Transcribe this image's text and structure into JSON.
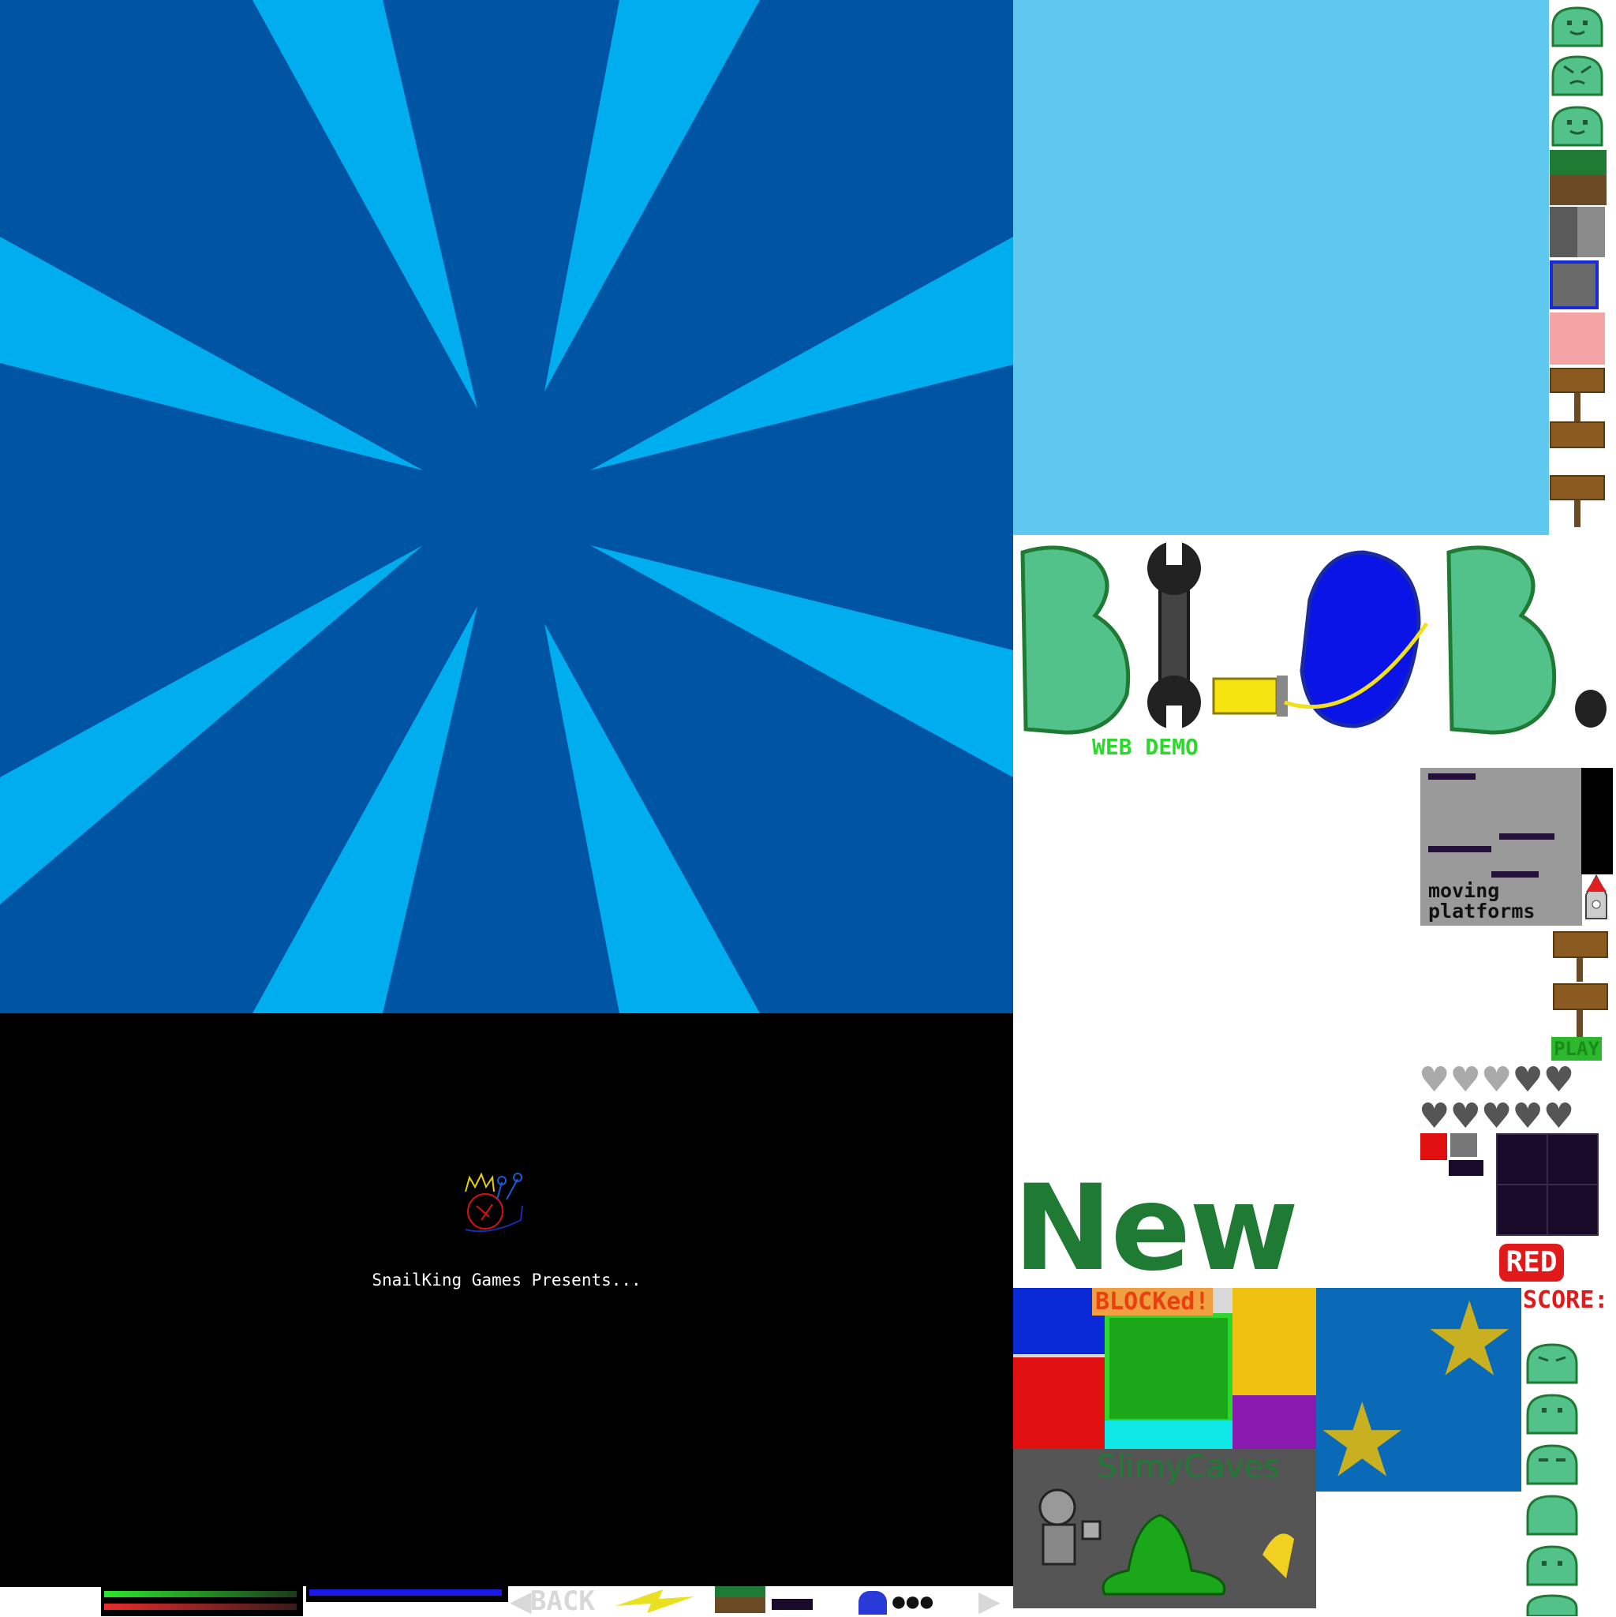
{
  "splash": {
    "studio_text": "SnailKing Games Presents..."
  },
  "title": {
    "logo_text": "BLOB.",
    "subtitle": "WEB DEMO"
  },
  "panels": {
    "moving_platforms": "moving platforms",
    "play": "PLAY",
    "new_game": "New Game",
    "red": "RED",
    "score": "SCORE:",
    "blocked": "BLOCKed!",
    "slimy_caves": "SlimyCaves",
    "back": "BACK"
  },
  "colors": {
    "burst_dark": "#0054a4",
    "burst_light": "#00adee",
    "sky": "#5ec8ee",
    "slime": "#52c28a",
    "slime_outline": "#1f7a34",
    "new_game": "#1f7a34"
  }
}
